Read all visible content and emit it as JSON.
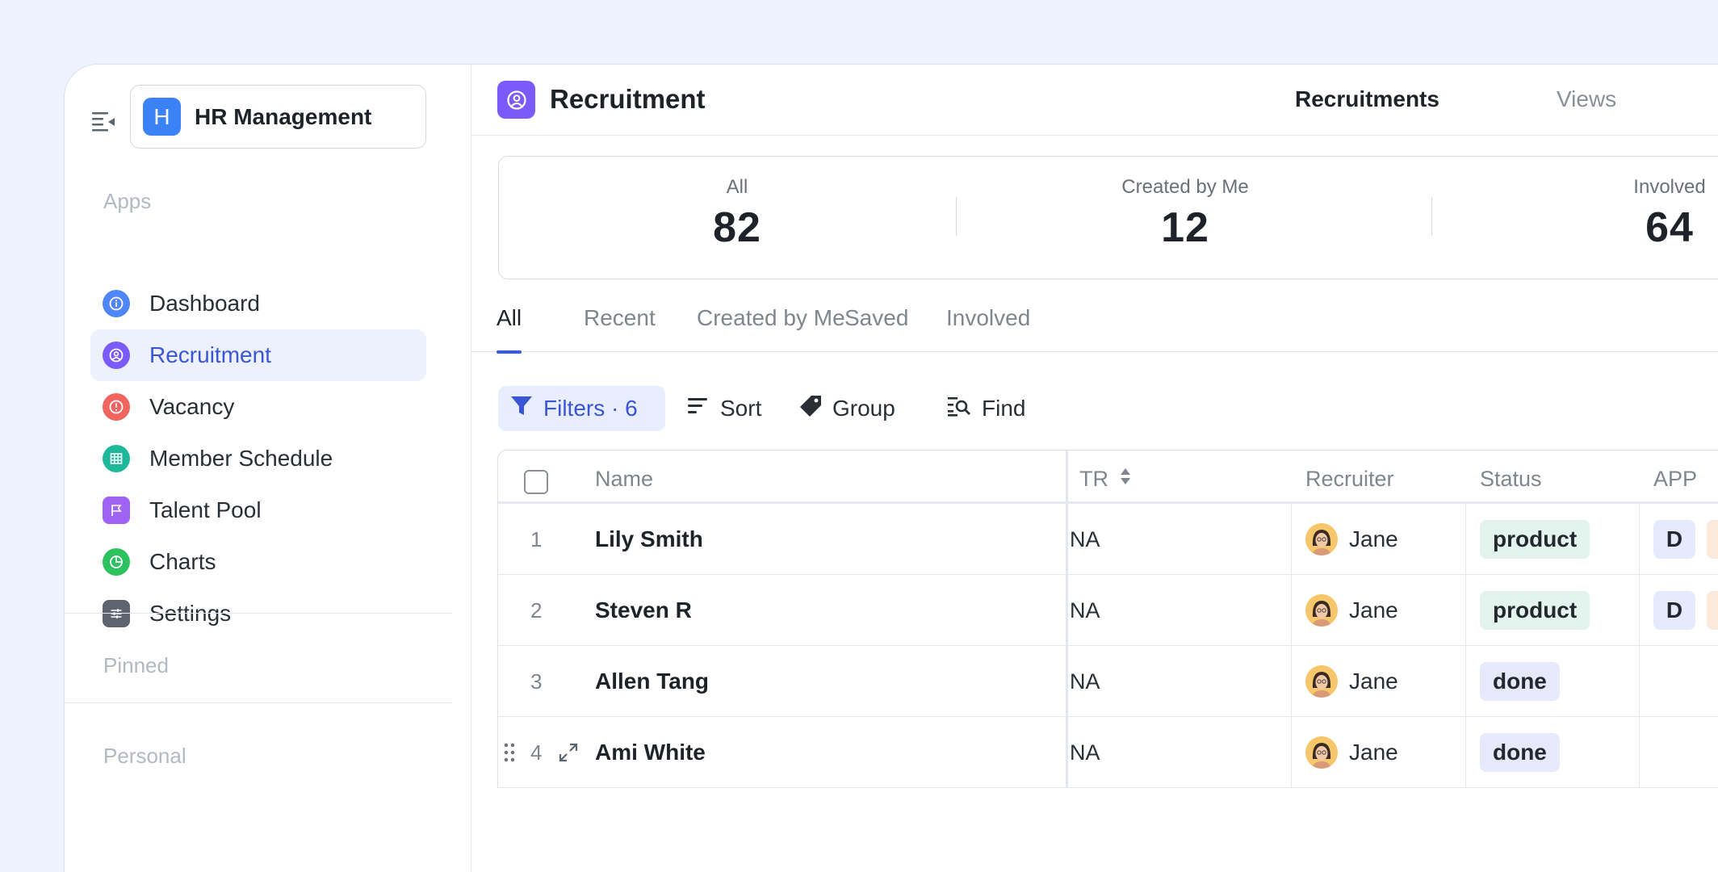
{
  "sidebar": {
    "workspace": {
      "avatar_letter": "H",
      "name": "HR Management",
      "color": "#3b82f6"
    },
    "apps_label": "Apps",
    "items": [
      {
        "label": "Dashboard",
        "icon": "info-icon",
        "color": "#4f86f7",
        "active": false
      },
      {
        "label": "Recruitment",
        "icon": "user-circle-icon",
        "color": "#7a5af8",
        "active": true
      },
      {
        "label": "Vacancy",
        "icon": "alert-icon",
        "color": "#f0645f",
        "active": false
      },
      {
        "label": "Member Schedule",
        "icon": "grid-icon",
        "color": "#1fb89a",
        "active": false
      },
      {
        "label": "Talent Pool",
        "icon": "flag-icon",
        "color": "#a064f4",
        "active": false
      },
      {
        "label": "Charts",
        "icon": "pie-icon",
        "color": "#2ec25e",
        "active": false
      },
      {
        "label": "Settings",
        "icon": "sliders-icon",
        "color": "#5d6470",
        "active": false
      }
    ],
    "pinned_label": "Pinned",
    "personal_label": "Personal"
  },
  "header": {
    "title": "Recruitment",
    "icon": "user-circle-icon",
    "tabs": [
      "Recruitments",
      "Views"
    ]
  },
  "stats": [
    {
      "label": "All",
      "value": "82"
    },
    {
      "label": "Created by Me",
      "value": "12"
    },
    {
      "label": "Involved",
      "value": "64"
    }
  ],
  "tabs": [
    "All",
    "Recent",
    "Created by Me",
    "Saved",
    "Involved"
  ],
  "toolbar": {
    "filters": "Filters · 6",
    "sort": "Sort",
    "group": "Group",
    "find": "Find"
  },
  "table": {
    "columns": [
      "Name",
      "TR",
      "Recruiter",
      "Status",
      "APP"
    ],
    "rows": [
      {
        "num": "1",
        "name": "Lily Smith",
        "tr": "NA",
        "recruiter": "Jane",
        "status": "product",
        "app": "D"
      },
      {
        "num": "2",
        "name": "Steven R",
        "tr": "NA",
        "recruiter": "Jane",
        "status": "product",
        "app": "D"
      },
      {
        "num": "3",
        "name": "Allen Tang",
        "tr": "NA",
        "recruiter": "Jane",
        "status": "done",
        "app": ""
      },
      {
        "num": "4",
        "name": "Ami White",
        "tr": "NA",
        "recruiter": "Jane",
        "status": "done",
        "app": ""
      }
    ]
  },
  "colors": {
    "accent": "#3a55d6",
    "background": "#eef2fc",
    "status_product": "#e3f4ef",
    "status_done": "#e7e9fb"
  }
}
